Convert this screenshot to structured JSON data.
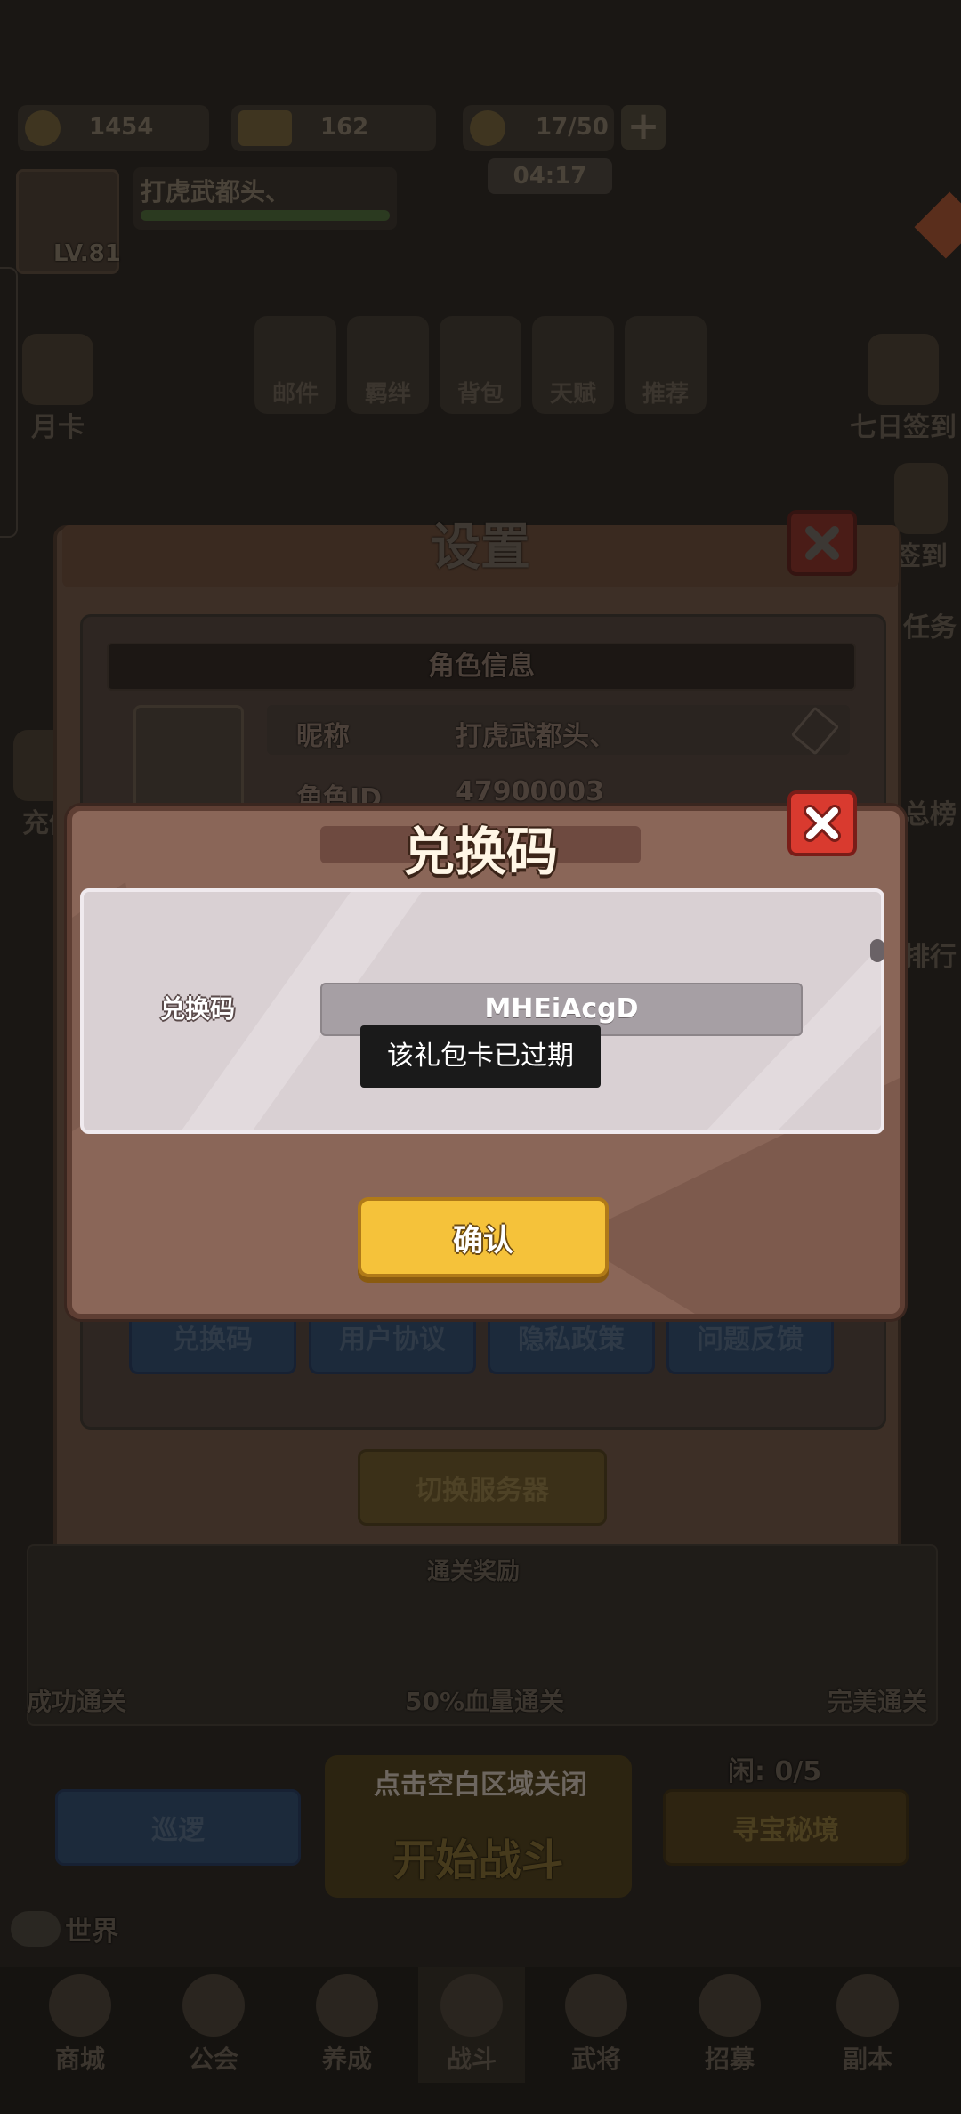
{
  "resources": [
    {
      "icon": "gold-coin-icon",
      "value": "1454"
    },
    {
      "icon": "gold-bar-icon",
      "value": "162"
    },
    {
      "icon": "stamina-icon",
      "value": "17/50"
    }
  ],
  "timer": "04:17",
  "player": {
    "name": "打虎武都头、",
    "level": "LV.81"
  },
  "top_features": [
    "邮件",
    "羁绊",
    "背包",
    "天赋",
    "推荐"
  ],
  "left_side": [
    "月卡",
    "充值"
  ],
  "right_side": [
    "七日签到",
    "签到",
    "任务",
    "总榜",
    "排行"
  ],
  "settings": {
    "title": "设置",
    "section_title": "角色信息",
    "nickname_label": "昵称",
    "nickname_value": "打虎武都头、",
    "role_id_label": "角色ID",
    "role_id_value": "47900003",
    "buttons": [
      "兑换码",
      "用户协议",
      "隐私政策",
      "问题反馈"
    ],
    "switch_server": "切换服务器"
  },
  "battle": {
    "header": "通关奖励",
    "rewards": [
      "成功通关",
      "50%血量通关",
      "完美通关"
    ],
    "idle_count": "闲: 0/5",
    "patrol": "巡逻",
    "treasure": "寻宝秘境",
    "start": "开始战斗",
    "hint": "点击空白区域关闭",
    "world_chat": "世界"
  },
  "bottom_nav": [
    "商城",
    "公会",
    "养成",
    "战斗",
    "武将",
    "招募",
    "副本"
  ],
  "modal": {
    "title": "兑换码",
    "field_label": "兑换码",
    "code_value": "MHEiAcgD",
    "toast": "该礼包卡已过期",
    "confirm": "确认"
  },
  "colors": {
    "confirm": "#f5c23a",
    "close": "#d93a2f",
    "modal_bg": "#8a6658"
  }
}
